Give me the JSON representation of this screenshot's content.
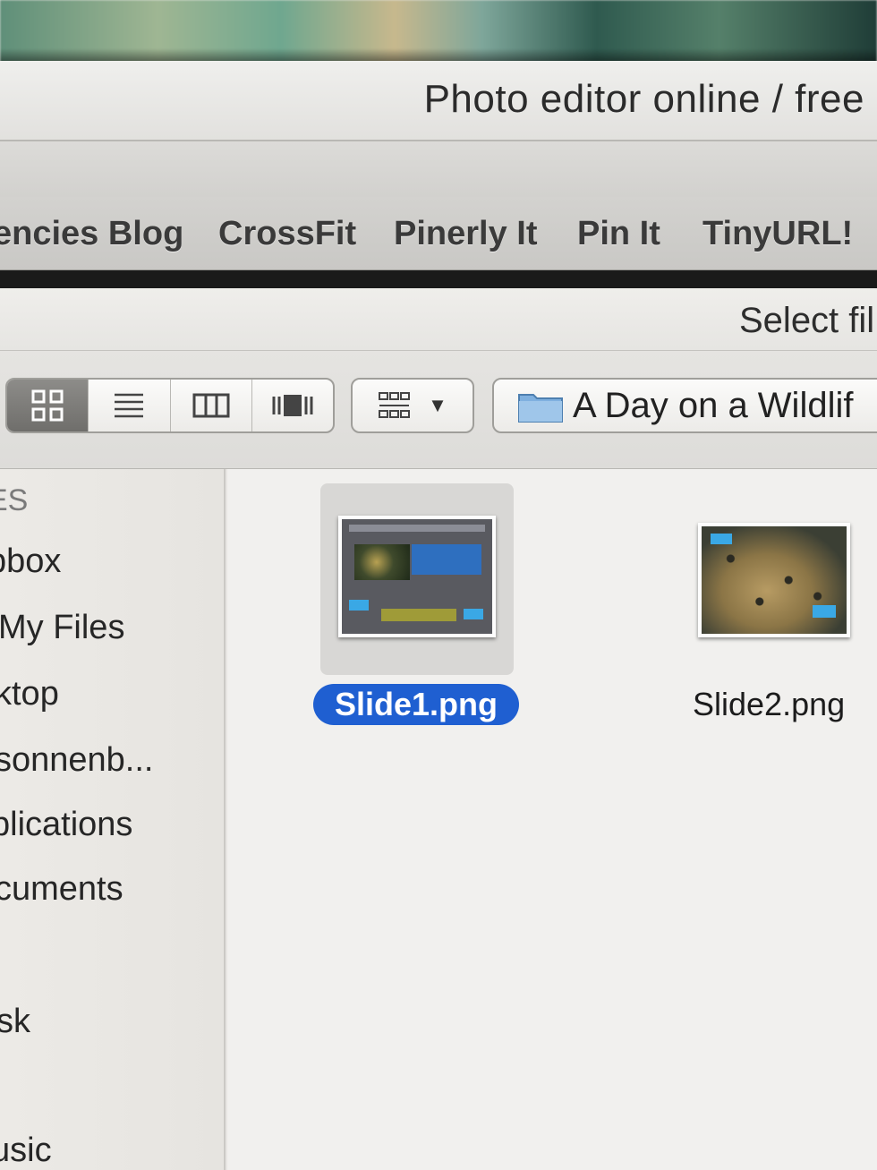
{
  "browser": {
    "window_title": "Photo editor online / free",
    "bookmarks": [
      "encies Blog",
      "CrossFit",
      "Pinerly It",
      "Pin It",
      "TinyURL!"
    ]
  },
  "dialog": {
    "title": "Select fil",
    "current_folder": "A Day on a Wildlif",
    "view_modes": [
      "icon-view",
      "list-view",
      "column-view",
      "cover-flow-view"
    ],
    "active_view": "icon-view"
  },
  "sidebar": {
    "header": "ES",
    "items": [
      "pbox",
      "My Files",
      "ktop",
      "sonnenb...",
      "plications",
      "cuments",
      "sk",
      "usic"
    ]
  },
  "files": [
    {
      "name": "Slide1.png",
      "selected": true
    },
    {
      "name": "Slide2.png",
      "selected": false
    }
  ],
  "colors": {
    "selection": "#1f5fd1",
    "thumbnail_accent": "#3aa8e5"
  }
}
